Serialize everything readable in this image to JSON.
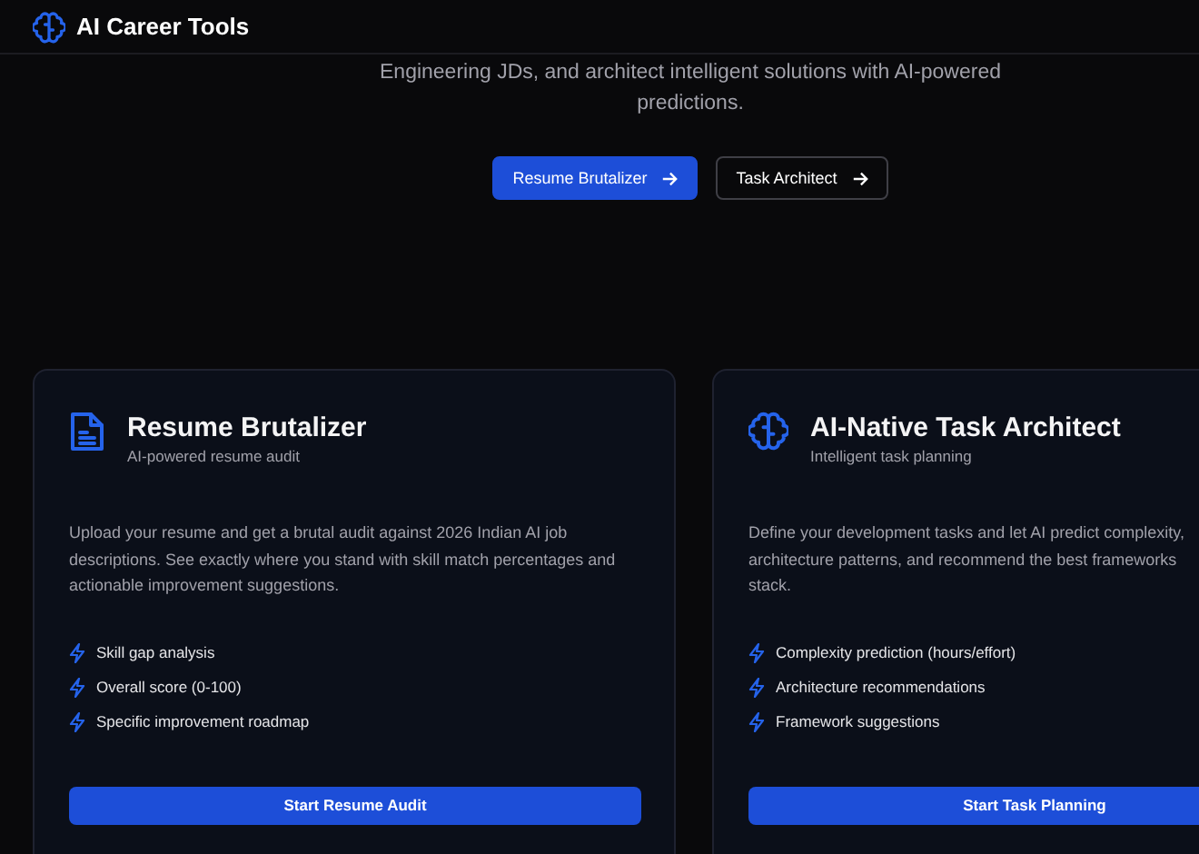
{
  "header": {
    "title": "AI Career Tools"
  },
  "hero": {
    "text": "Engineering JDs, and architect intelligent solutions with AI-powered\npredictions.",
    "buttons": [
      {
        "label": "Resume Brutalizer",
        "kind": "primary"
      },
      {
        "label": "Task Architect",
        "kind": "outline"
      }
    ]
  },
  "cards": [
    {
      "kind": "document",
      "title": "Resume Brutalizer",
      "subtitle": "AI-powered resume audit",
      "description": "Upload your resume and get a brutal audit against 2026 Indian AI job\ndescriptions. See exactly where you stand with skill match percentages and\nactionable improvement suggestions.",
      "features": [
        "Skill gap analysis",
        "Overall score (0-100)",
        "Specific improvement roadmap"
      ],
      "button": "Start Resume Audit"
    },
    {
      "kind": "brain",
      "title": "AI-Native Task Architect",
      "subtitle": "Intelligent task planning",
      "description": "Define your development tasks and let AI predict complexity,\narchitecture patterns, and recommend the best frameworks\nstack.",
      "features": [
        "Complexity prediction (hours/effort)",
        "Architecture recommendations",
        "Framework suggestions"
      ],
      "button": "Start Task Planning"
    }
  ]
}
